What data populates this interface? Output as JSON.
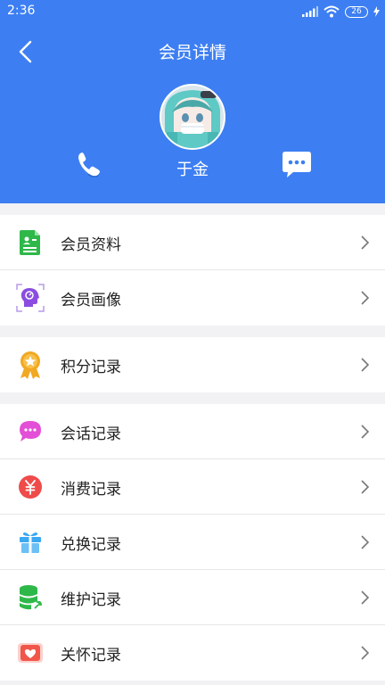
{
  "status_bar": {
    "time": "2:36",
    "battery": "26"
  },
  "header": {
    "title": "会员详情",
    "member_name": "于金",
    "background_color": "#3d7ff2"
  },
  "icons": {
    "back": "back-arrow-icon",
    "phone": "phone-icon",
    "message": "message-icon"
  },
  "groups": [
    {
      "items": [
        {
          "label": "会员资料",
          "icon": "member-profile-icon",
          "color": "#2fb84a"
        },
        {
          "label": "会员画像",
          "icon": "member-portrait-icon",
          "color": "#8a4de0"
        }
      ]
    },
    {
      "items": [
        {
          "label": "积分记录",
          "icon": "points-medal-icon",
          "color": "#f1a823"
        }
      ]
    },
    {
      "items": [
        {
          "label": "会话记录",
          "icon": "chat-bubble-icon",
          "color": "#e34fd6"
        },
        {
          "label": "消费记录",
          "icon": "yuan-icon",
          "color": "#ef4b4b"
        },
        {
          "label": "兑换记录",
          "icon": "gift-icon",
          "color": "#3aa8f2"
        },
        {
          "label": "维护记录",
          "icon": "database-wrench-icon",
          "color": "#2fb84a"
        },
        {
          "label": "关怀记录",
          "icon": "heart-envelope-icon",
          "color": "#f0574a"
        }
      ]
    }
  ]
}
